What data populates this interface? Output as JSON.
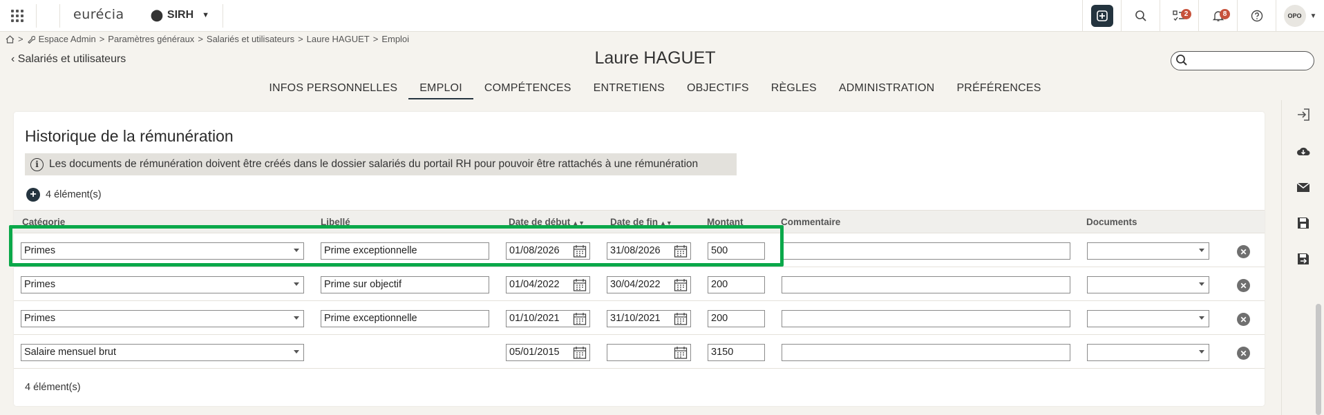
{
  "topbar": {
    "logo": "eurécia",
    "module": "SIRH",
    "tasks_badge": "2",
    "notifications_badge": "8",
    "avatar_initials": "OPO"
  },
  "breadcrumb": {
    "items": [
      "Espace Admin",
      "Paramètres généraux",
      "Salariés et utilisateurs",
      "Laure HAGUET",
      "Emploi"
    ]
  },
  "header": {
    "back_label": "Salariés et utilisateurs",
    "title": "Laure HAGUET",
    "search_placeholder": ""
  },
  "tabs": [
    {
      "label": "INFOS PERSONNELLES"
    },
    {
      "label": "EMPLOI"
    },
    {
      "label": "COMPÉTENCES"
    },
    {
      "label": "ENTRETIENS"
    },
    {
      "label": "OBJECTIFS"
    },
    {
      "label": "RÈGLES"
    },
    {
      "label": "ADMINISTRATION"
    },
    {
      "label": "PRÉFÉRENCES"
    }
  ],
  "section": {
    "title": "Historique de la rémunération",
    "info": "Les documents de rémunération doivent être créés dans le dossier salariés du portail RH pour pouvoir être rattachés à une rémunération",
    "add_count": "4 élément(s)",
    "footer_count": "4 élément(s)"
  },
  "table": {
    "headers": {
      "categorie": "Catégorie",
      "libelle": "Libellé",
      "date_debut": "Date de début",
      "date_fin": "Date de fin",
      "montant": "Montant",
      "commentaire": "Commentaire",
      "documents": "Documents"
    },
    "rows": [
      {
        "categorie": "Primes",
        "libelle": "Prime exceptionnelle",
        "date_debut": "01/08/2026",
        "date_fin": "31/08/2026",
        "montant": "500",
        "commentaire": "",
        "documents": ""
      },
      {
        "categorie": "Primes",
        "libelle": "Prime sur objectif",
        "date_debut": "01/04/2022",
        "date_fin": "30/04/2022",
        "montant": "200",
        "commentaire": "",
        "documents": ""
      },
      {
        "categorie": "Primes",
        "libelle": "Prime exceptionnelle",
        "date_debut": "01/10/2021",
        "date_fin": "31/10/2021",
        "montant": "200",
        "commentaire": "",
        "documents": ""
      },
      {
        "categorie": "Salaire mensuel brut",
        "libelle": "",
        "date_debut": "05/01/2015",
        "date_fin": "",
        "montant": "3150",
        "commentaire": "",
        "documents": ""
      }
    ]
  },
  "colors": {
    "accent_dark": "#24343f",
    "badge": "#c7523c",
    "highlight": "#0aa84a",
    "background": "#f5f3ee"
  }
}
